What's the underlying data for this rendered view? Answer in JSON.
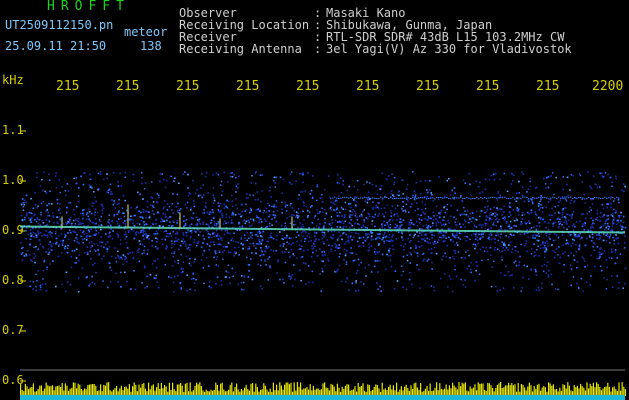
{
  "header": {
    "title": "HROFFT",
    "filename": "UT2509112150.pn",
    "meteor_label": "meteor",
    "datetime": "25.09.11 21:50",
    "count": "138"
  },
  "meta": [
    {
      "label": "Observer",
      "value": "Masaki Kano"
    },
    {
      "label": "Receiving Location",
      "value": "Shibukawa, Gunma, Japan"
    },
    {
      "label": "Receiver",
      "value": "RTL-SDR SDR# 43dB L15 103.2MHz CW"
    },
    {
      "label": "Receiving Antenna",
      "value": "3el Yagi(V) Az 330 for Vladivostok"
    }
  ],
  "axis": {
    "y_unit": "kHz",
    "x_ticks": [
      "215",
      "215",
      "215",
      "215",
      "215",
      "215",
      "215",
      "215",
      "215",
      "2200"
    ],
    "y_ticks": [
      "1.1",
      "1.0",
      "0.9",
      "0.8",
      "0.7",
      "0.6"
    ]
  },
  "colors": {
    "accent": "#d9d000",
    "title": "#19d419",
    "filename": "#7cc9ff",
    "meta": "#cfcfcf",
    "noise_low": "#1a2eb0",
    "noise_mid": "#2f6cff",
    "carrier": "#5fe0c0"
  },
  "chart_data": {
    "type": "heatmap",
    "ylabel": "kHz",
    "ylim": [
      0.58,
      1.16
    ],
    "carrier_frequency_khz": 0.905,
    "band_khz": [
      0.78,
      1.02
    ]
  }
}
